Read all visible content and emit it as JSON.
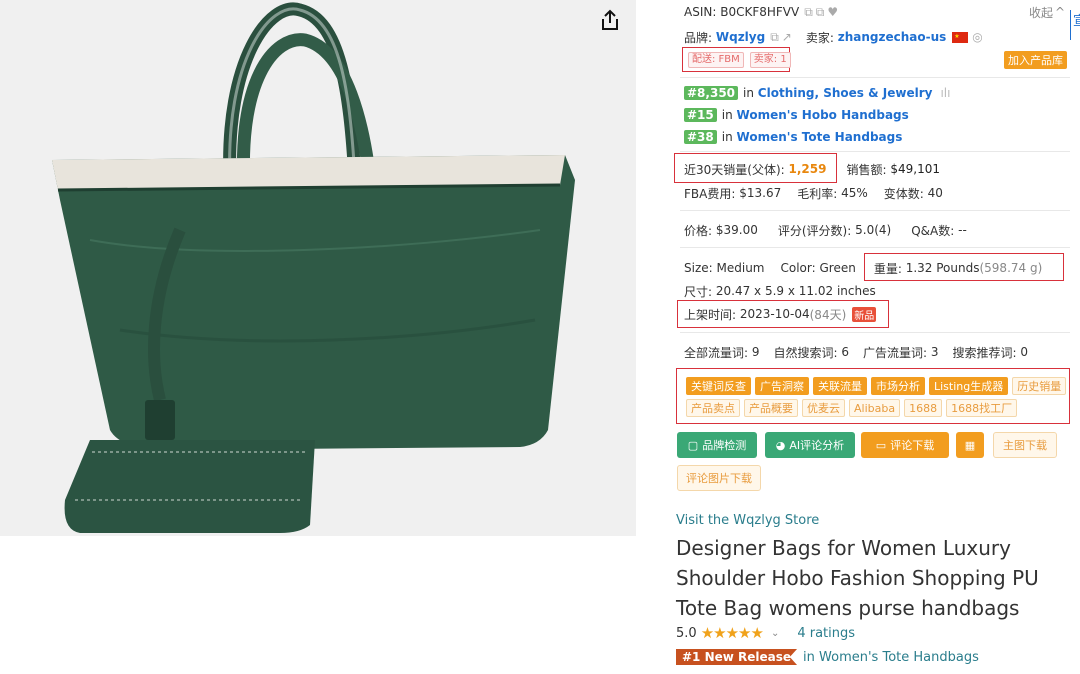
{
  "product_image": {
    "alt": "green tote bag",
    "colors": {
      "bag": "#2f5a46",
      "bag_dark": "#1f3f31",
      "bag_light": "#4a7a63",
      "lining": "#e8e4dc"
    }
  },
  "panel": {
    "asin_label": "ASIN:",
    "asin_value": "B0CKF8HFVV",
    "collapse": "收起",
    "brand_label": "品牌:",
    "brand_value": "Wqzlyg",
    "seller_label": "卖家:",
    "seller_value": "zhangzechao-us",
    "delivery_tag": "配送: FBM",
    "seller_count_tag": "卖家: 1",
    "add_library": "加入产品库",
    "ranks": [
      {
        "rank": "#8,350",
        "category": "Clothing, Shoes & Jewelry"
      },
      {
        "rank": "#15",
        "category": "Women's Hobo Handbags"
      },
      {
        "rank": "#38",
        "category": "Women's Tote Handbags"
      }
    ],
    "in_text": "in",
    "sales30_label": "近30天销量(父体):",
    "sales30_value": "1,259",
    "revenue_label": "销售额:",
    "revenue_value": "$49,101",
    "fba_label": "FBA费用:",
    "fba_value": "$13.67",
    "margin_label": "毛利率:",
    "margin_value": "45%",
    "variants_label": "变体数:",
    "variants_value": "40",
    "price_label": "价格:",
    "price_value": "$39.00",
    "rating_label": "评分(评分数):",
    "rating_value": "5.0(4)",
    "qa_label": "Q&A数:",
    "qa_value": "--",
    "size_label": "Size:",
    "size_value": "Medium",
    "color_label": "Color:",
    "color_value": "Green",
    "weight_label": "重量:",
    "weight_value": "1.32 Pounds",
    "weight_grams": "(598.74 g)",
    "dims_label": "尺寸:",
    "dims_value": "20.47 x 5.9 x 11.02 inches",
    "listed_label": "上架时间:",
    "listed_value": "2023-10-04",
    "listed_days": "(84天)",
    "new_tag": "新品",
    "kw_all_label": "全部流量词:",
    "kw_all_value": "9",
    "kw_organic_label": "自然搜索词:",
    "kw_organic_value": "6",
    "kw_ad_label": "广告流量词:",
    "kw_ad_value": "3",
    "kw_rec_label": "搜索推荐词:",
    "kw_rec_value": "0",
    "tags_row1": [
      "关键词反查",
      "广告洞察",
      "关联流量",
      "市场分析",
      "Listing生成器",
      "历史销量"
    ],
    "tags_row2": [
      "产品卖点",
      "产品概要",
      "优麦云",
      "Alibaba",
      "1688",
      "1688找工厂"
    ],
    "btn_brand": "品牌检测",
    "btn_ai": "AI评论分析",
    "btn_reviews": "评论下载",
    "btn_main_img": "主图下载",
    "btn_review_img": "评论图片下载"
  },
  "store_link": "Visit the Wqzlyg Store",
  "title": "Designer Bags for Women Luxury Shoulder Hobo Fashion Shopping PU Tote Bag womens purse handbags",
  "rating": {
    "value": "5.0",
    "stars": 5,
    "count_text": "4 ratings"
  },
  "badge": {
    "text": "#1 New Release",
    "category_text": "in Women's Tote Handbags"
  },
  "edge_text": "宣"
}
